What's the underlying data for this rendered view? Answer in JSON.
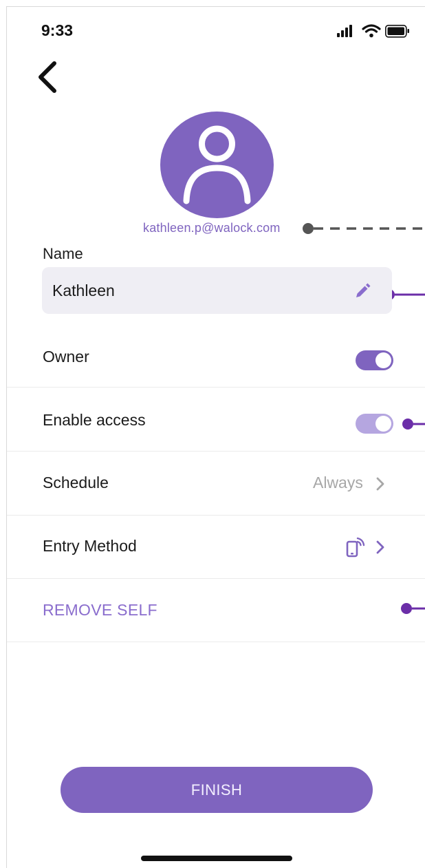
{
  "status_bar": {
    "time": "9:33"
  },
  "profile": {
    "email": "kathleen.p@walock.com"
  },
  "name_field": {
    "label": "Name",
    "value": "Kathleen"
  },
  "settings": {
    "owner": {
      "label": "Owner",
      "enabled": true
    },
    "enable_access": {
      "label": "Enable access",
      "enabled": true
    },
    "schedule": {
      "label": "Schedule",
      "value": "Always"
    },
    "entry_method": {
      "label": "Entry Method"
    }
  },
  "remove_self_label": "REMOVE SELF",
  "finish_label": "FINISH",
  "icons": {
    "back": "chevron-left-icon",
    "edit": "pencil-icon",
    "avatar": "user-icon",
    "entry_method": "phone-nfc-icon",
    "signal": "cellular-signal-icon",
    "wifi": "wifi-icon",
    "battery": "battery-icon"
  },
  "colors": {
    "accent": "#7f64bf",
    "accent_light": "#b5a6e0",
    "field_bg": "#efeef4",
    "muted_text": "#a7a7a7",
    "callout_gray": "#555555"
  }
}
